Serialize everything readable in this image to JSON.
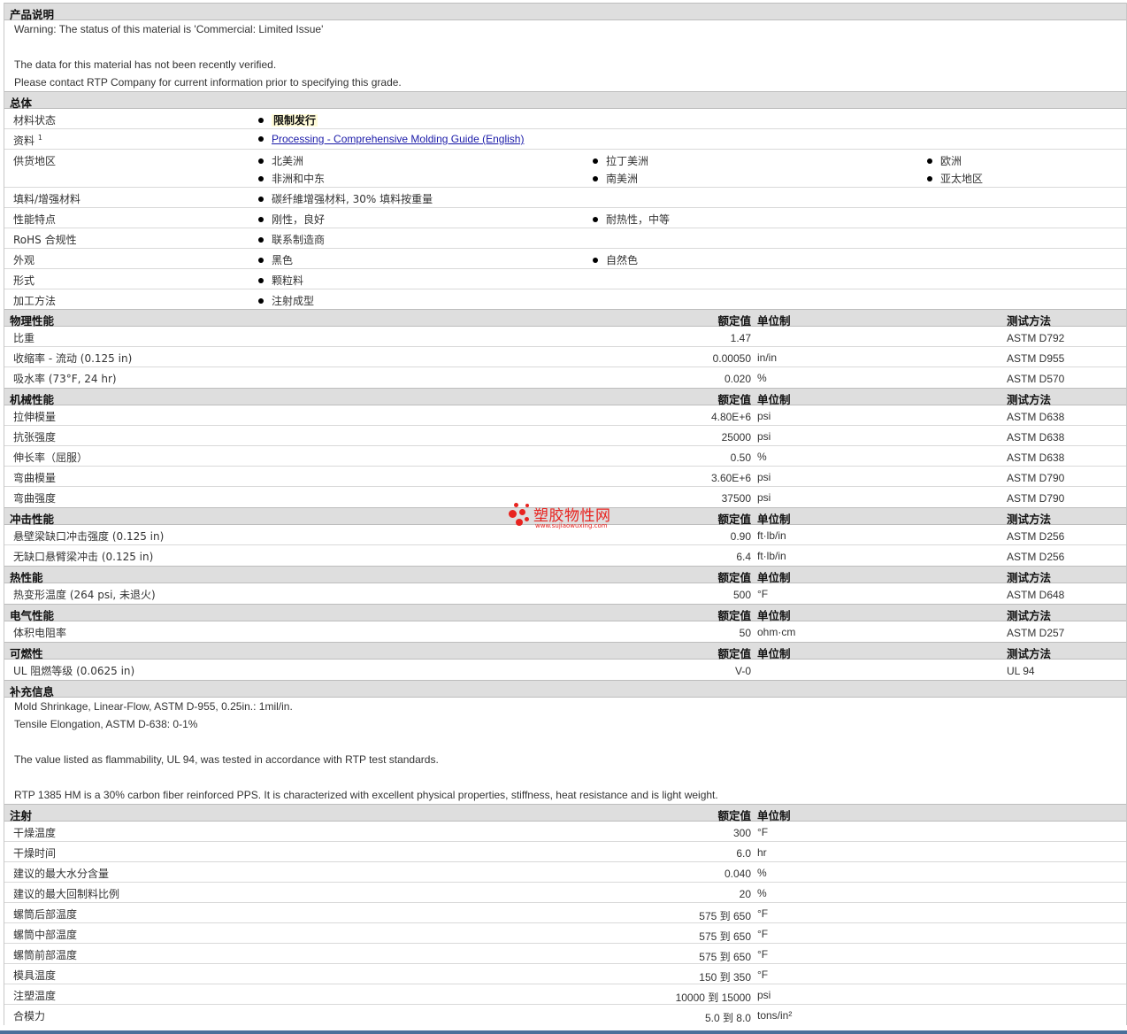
{
  "desc": {
    "title": "产品说明",
    "lines": [
      "Warning: The status of this material is 'Commercial: Limited Issue'",
      "",
      "The data for this material has not been recently verified.",
      "Please contact RTP Company for current information prior to specifying this grade."
    ]
  },
  "general": {
    "title": "总体",
    "rows": {
      "status": {
        "label": "材料状态",
        "value": "限制发行"
      },
      "docs": {
        "label": "资料",
        "sup": "1",
        "link": "Processing - Comprehensive Molding Guide (English)"
      },
      "supply": {
        "label": "供货地区",
        "items": [
          "北美洲",
          "拉丁美洲",
          "欧洲",
          "非洲和中东",
          "南美洲",
          "亚太地区"
        ]
      },
      "filler": {
        "label": "填料/增强材料",
        "value": "碳纤維增强材料, 30% 填料按重量"
      },
      "features": {
        "label": "性能特点",
        "items": [
          "刚性，良好",
          "耐热性，中等"
        ]
      },
      "rohs": {
        "label": "RoHS 合规性",
        "value": "联系制造商"
      },
      "appearance": {
        "label": "外观",
        "items": [
          "黑色",
          "自然色"
        ]
      },
      "form": {
        "label": "形式",
        "value": "颗粒料"
      },
      "method": {
        "label": "加工方法",
        "value": "注射成型"
      }
    }
  },
  "col_headers": {
    "nominal": "额定值",
    "unit": "单位制",
    "test": "测试方法"
  },
  "physical": {
    "title": "物理性能",
    "rows": [
      {
        "label": "比重",
        "value": "1.47",
        "unit": "",
        "method": "ASTM D792"
      },
      {
        "label": "收缩率 - 流动 (0.125 in)",
        "value": "0.00050",
        "unit": "in/in",
        "method": "ASTM D955"
      },
      {
        "label": "吸水率 (73°F, 24 hr)",
        "value": "0.020",
        "unit": "%",
        "method": "ASTM D570"
      }
    ]
  },
  "mechanical": {
    "title": "机械性能",
    "rows": [
      {
        "label": "拉伸模量",
        "value": "4.80E+6",
        "unit": "psi",
        "method": "ASTM D638"
      },
      {
        "label": "抗张强度",
        "value": "25000",
        "unit": "psi",
        "method": "ASTM D638"
      },
      {
        "label": "伸长率（屈服）",
        "value": "0.50",
        "unit": "%",
        "method": "ASTM D638"
      },
      {
        "label": "弯曲模量",
        "value": "3.60E+6",
        "unit": "psi",
        "method": "ASTM D790"
      },
      {
        "label": "弯曲强度",
        "value": "37500",
        "unit": "psi",
        "method": "ASTM D790"
      }
    ]
  },
  "impact": {
    "title": "冲击性能",
    "rows": [
      {
        "label": "悬壁梁缺口冲击强度 (0.125 in)",
        "value": "0.90",
        "unit": "ft·lb/in",
        "method": "ASTM D256"
      },
      {
        "label": "无缺口悬臂梁冲击 (0.125 in)",
        "value": "6.4",
        "unit": "ft·lb/in",
        "method": "ASTM D256"
      }
    ]
  },
  "thermal": {
    "title": "热性能",
    "rows": [
      {
        "label": "热变形温度 (264 psi, 未退火)",
        "value": "500",
        "unit": "°F",
        "method": "ASTM D648"
      }
    ]
  },
  "electrical": {
    "title": "电气性能",
    "rows": [
      {
        "label": "体积电阻率",
        "value": "50",
        "unit": "ohm·cm",
        "method": "ASTM D257"
      }
    ]
  },
  "flammability": {
    "title": "可燃性",
    "rows": [
      {
        "label": "UL 阻燃等级 (0.0625 in)",
        "value": "V-0",
        "unit": "",
        "method": "UL 94"
      }
    ]
  },
  "supplement": {
    "title": "补充信息",
    "lines": [
      "Mold Shrinkage, Linear-Flow, ASTM D-955, 0.25in.: 1mil/in.",
      "Tensile Elongation, ASTM D-638: 0-1%",
      "",
      "The value listed as flammability, UL 94, was tested in accordance with RTP test standards.",
      "",
      "RTP 1385 HM is a 30% carbon fiber reinforced PPS. It is characterized with excellent physical properties, stiffness, heat resistance and is light weight."
    ]
  },
  "injection": {
    "title": "注射",
    "rows": [
      {
        "label": "干燥温度",
        "value": "300",
        "unit": "°F"
      },
      {
        "label": "干燥时间",
        "value": "6.0",
        "unit": "hr"
      },
      {
        "label": "建议的最大水分含量",
        "value": "0.040",
        "unit": "%"
      },
      {
        "label": "建议的最大回制料比例",
        "value": "20",
        "unit": "%"
      },
      {
        "label": "螺筒后部温度",
        "value": "575 到  650",
        "unit": "°F"
      },
      {
        "label": "螺筒中部温度",
        "value": "575 到  650",
        "unit": "°F"
      },
      {
        "label": "螺筒前部温度",
        "value": "575 到  650",
        "unit": "°F"
      },
      {
        "label": "模具温度",
        "value": "150 到  350",
        "unit": "°F"
      },
      {
        "label": "注塑温度",
        "value": "10000 到  15000",
        "unit": "psi"
      },
      {
        "label": "合模力",
        "value": "5.0 到  8.0",
        "unit": "tons/in²"
      }
    ]
  },
  "watermark": {
    "text": "塑胶物性网",
    "url": "www.sujiaowuxing.com"
  },
  "colors": {
    "header_bg": "#dedede",
    "link": "#1a1aa8",
    "watermark": "#e8231f"
  }
}
